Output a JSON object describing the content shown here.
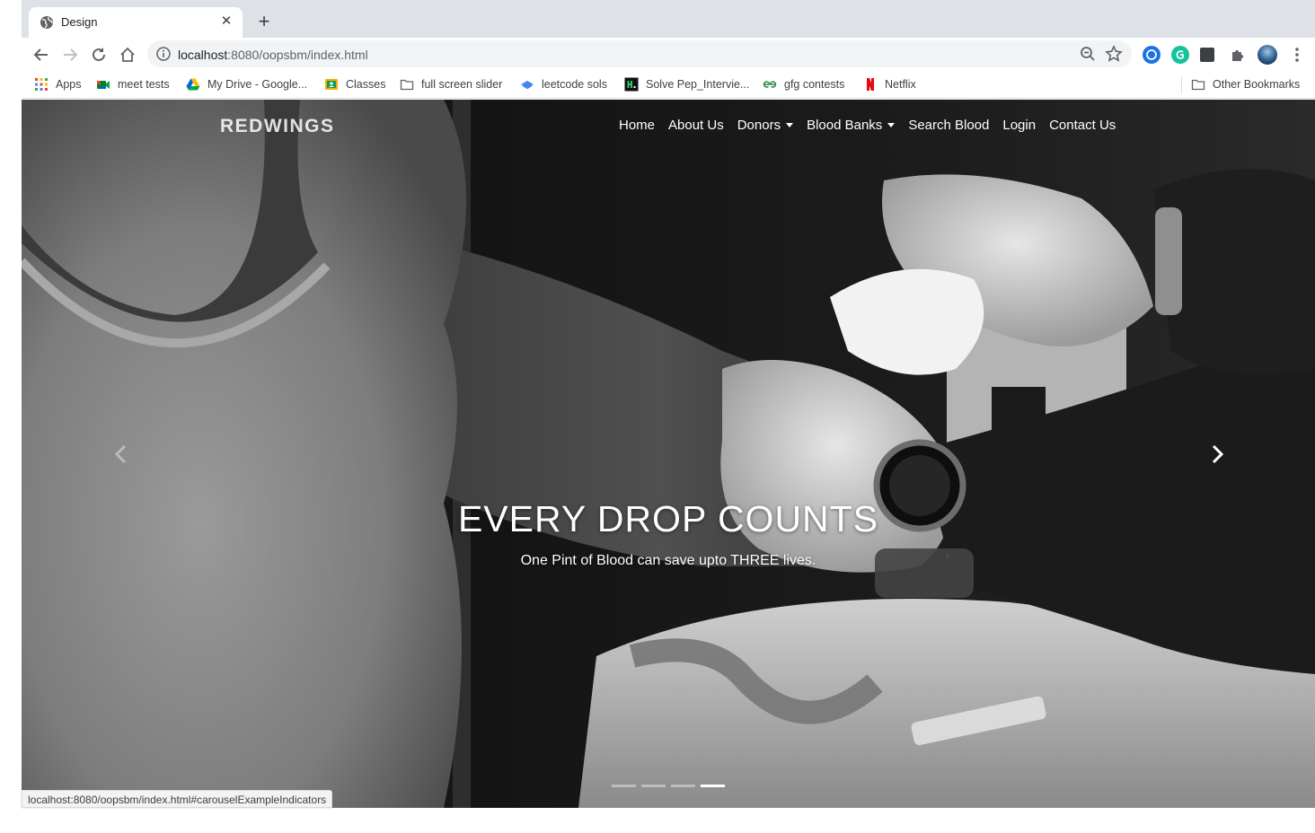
{
  "browser": {
    "tab": {
      "title": "Design",
      "favicon": "globe-icon"
    },
    "address_bar": {
      "host": "localhost",
      "path": ":8080/oopsbm/index.html"
    },
    "bookmarks": [
      {
        "label": "Apps",
        "icon": "apps-grid-icon"
      },
      {
        "label": "meet tests",
        "icon": "google-meet-icon"
      },
      {
        "label": "My Drive - Google...",
        "icon": "google-drive-icon"
      },
      {
        "label": "Classes",
        "icon": "google-classroom-icon"
      },
      {
        "label": "full screen slider",
        "icon": "folder-icon"
      },
      {
        "label": "leetcode sols",
        "icon": "bookmark-site-icon"
      },
      {
        "label": "Solve Pep_Intervie...",
        "icon": "hackerrank-icon"
      },
      {
        "label": "gfg contests",
        "icon": "geeksforgeeks-icon"
      },
      {
        "label": "Netflix",
        "icon": "netflix-icon"
      }
    ],
    "other_bookmarks": "Other Bookmarks",
    "status_url": "localhost:8080/oopsbm/index.html#carouselExampleIndicators"
  },
  "site": {
    "brand": "REDWINGS",
    "nav": [
      {
        "label": "Home",
        "dropdown": false
      },
      {
        "label": "About Us",
        "dropdown": false
      },
      {
        "label": "Donors",
        "dropdown": true
      },
      {
        "label": "Blood Banks",
        "dropdown": true
      },
      {
        "label": "Search Blood",
        "dropdown": false
      },
      {
        "label": "Login",
        "dropdown": false
      },
      {
        "label": "Contact Us",
        "dropdown": false
      }
    ],
    "hero": {
      "heading": "EVERY DROP COUNTS",
      "subheading": "One Pint of Blood can save upto THREE lives."
    },
    "carousel": {
      "slides": 4,
      "active_index": 3
    }
  },
  "colors": {
    "chrome_tabstrip": "#dee1e6",
    "omnibox_bg": "#f1f3f4",
    "hero_text": "#ffffff"
  }
}
